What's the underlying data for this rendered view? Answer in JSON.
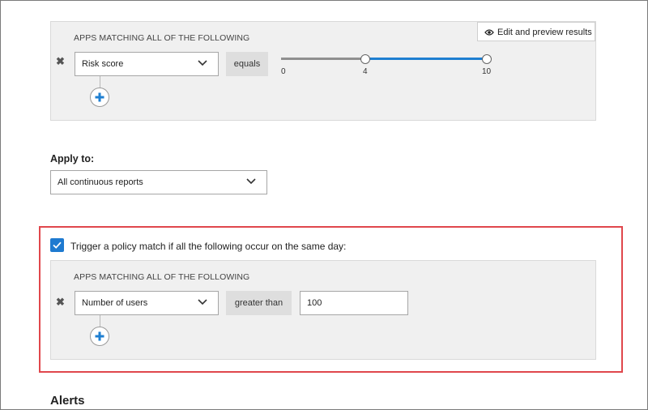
{
  "policy_filter": {
    "title": "APPS MATCHING ALL OF THE FOLLOWING",
    "edit_preview_label": "Edit and preview results",
    "field_value": "Risk score",
    "operator_label": "equals",
    "slider": {
      "min_label": "0",
      "mid_label": "4",
      "max_label": "10",
      "min": 0,
      "max": 10,
      "range_low": 4,
      "range_high": 10
    }
  },
  "apply_to": {
    "label": "Apply to:",
    "value": "All continuous reports"
  },
  "trigger": {
    "checked": true,
    "text": "Trigger a policy match if all the following occur on the same day:",
    "filter": {
      "title": "APPS MATCHING ALL OF THE FOLLOWING",
      "field_value": "Number of users",
      "operator_label": "greater than",
      "input_value": "100"
    }
  },
  "alerts": {
    "heading": "Alerts"
  },
  "colors": {
    "accent_blue": "#1f7fd1",
    "highlight_red": "#e0474c",
    "panel_bg": "#f0f0f0"
  }
}
